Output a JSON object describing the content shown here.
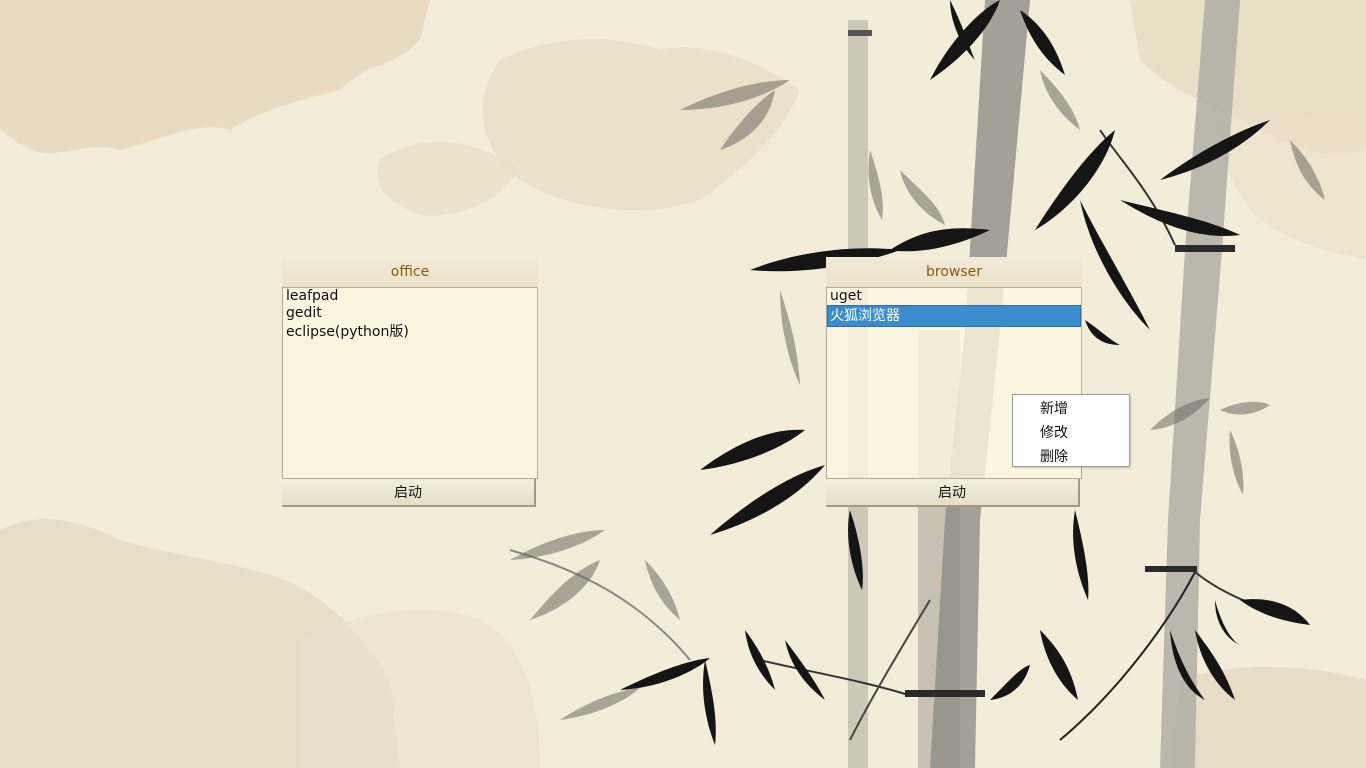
{
  "office": {
    "title": "office",
    "items": [
      "leafpad",
      "gedit",
      "eclipse(python版)"
    ],
    "start_label": "启动"
  },
  "browser": {
    "title": "browser",
    "items": [
      "uget",
      "火狐浏览器"
    ],
    "selected_index": 1,
    "start_label": "启动"
  },
  "context_menu": {
    "items": [
      "新增",
      "修改",
      "删除"
    ]
  },
  "colors": {
    "background": "#f2ecd9",
    "title_text": "#8a5a10",
    "selection": "#3a8ccd",
    "bamboo_dark": "#151515"
  }
}
